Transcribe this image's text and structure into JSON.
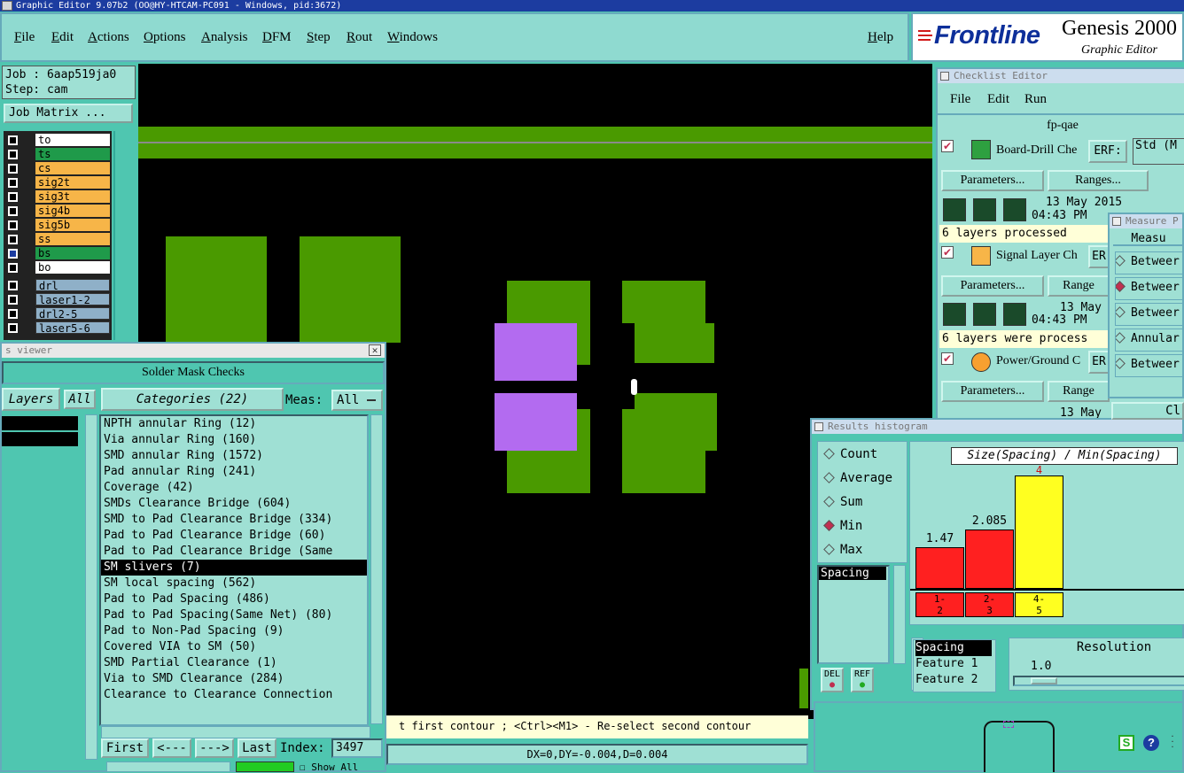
{
  "window": {
    "title": "Graphic Editor 9.07b2 (OO@HY-HTCAM-PC091 - Windows, pid:3672)"
  },
  "menu": {
    "items": [
      "File",
      "Edit",
      "Actions",
      "Options",
      "Analysis",
      "DFM",
      "Step",
      "Rout",
      "Windows"
    ],
    "help": "Help"
  },
  "brand": {
    "logo": "Frontline",
    "title": "Genesis 2000",
    "subtitle": "Graphic Editor"
  },
  "job": {
    "job_label": "Job : 6aap519ja0",
    "step_label": "Step: cam",
    "matrix_button": "Job Matrix ..."
  },
  "layers": [
    {
      "name": "to",
      "color": "#ffffff"
    },
    {
      "name": "ts",
      "color": "#1f9a4a"
    },
    {
      "name": "cs",
      "color": "#f7b548"
    },
    {
      "name": "sig2t",
      "color": "#f7b548"
    },
    {
      "name": "sig3t",
      "color": "#f7b548"
    },
    {
      "name": "sig4b",
      "color": "#f7b548"
    },
    {
      "name": "sig5b",
      "color": "#f7b548"
    },
    {
      "name": "ss",
      "color": "#f7b548"
    },
    {
      "name": "bs",
      "color": "#1f9a4a"
    },
    {
      "name": "bo",
      "color": "#ffffff"
    },
    {
      "name": "drl",
      "color": "#8fb0c8"
    },
    {
      "name": "laser1-2",
      "color": "#8fb0c8"
    },
    {
      "name": "drl2-5",
      "color": "#8fb0c8"
    },
    {
      "name": "laser5-6",
      "color": "#8fb0c8"
    }
  ],
  "checklist": {
    "title": "Checklist Editor",
    "menu": [
      "File",
      "Edit",
      "Run"
    ],
    "name": "fp-qae",
    "items": [
      {
        "label": "Board-Drill Che",
        "erf": "ERF:",
        "std": "Std (M",
        "params": "Parameters...",
        "ranges": "Ranges...",
        "date": "13 May 2015",
        "time": "04:43 PM",
        "status": "6 layers processed"
      },
      {
        "label": "Signal Layer Ch",
        "erf": "ER",
        "params": "Parameters...",
        "ranges": "Range",
        "date": "13 May",
        "time": "04:43 PM",
        "status": "6 layers were process"
      },
      {
        "label": "Power/Ground C",
        "erf": "ER",
        "params": "Parameters...",
        "ranges": "Range",
        "date": "13 May"
      }
    ]
  },
  "measure": {
    "title": "Measure P",
    "heading": "Measu",
    "options": [
      "Betweer",
      "Betweer",
      "Betweer",
      "Annular",
      "Betweer"
    ],
    "selected": 1
  },
  "sm_viewer": {
    "title": "s viewer",
    "heading": "Solder Mask Checks",
    "layers_label": "Layers",
    "layers_all": "All",
    "categories_label": "Categories (22)",
    "meas_label": "Meas:",
    "meas_value": "All",
    "categories": [
      "NPTH annular Ring (12)",
      "Via annular Ring (160)",
      "SMD annular Ring (1572)",
      "Pad annular Ring (241)",
      "Coverage (42)",
      "SMDs Clearance Bridge (604)",
      "SMD to Pad Clearance Bridge (334)",
      "Pad to Pad Clearance Bridge (60)",
      "Pad to Pad Clearance Bridge (Same",
      "SM slivers (7)",
      "SM local spacing (562)",
      "Pad to Pad Spacing (486)",
      "Pad to Pad Spacing(Same Net) (80)",
      "Pad to Non-Pad Spacing (9)",
      "Covered VIA to SM (50)",
      "SMD Partial Clearance (1)",
      "Via to SMD Clearance (284)",
      "Clearance to Clearance Connection"
    ],
    "selected_index": 9,
    "nav": {
      "first": "First",
      "prev": "<---",
      "next": "--->",
      "last": "Last",
      "index_label": "Index:",
      "index_value": "3497",
      "show_all": "Show All"
    }
  },
  "status": {
    "message": "t first contour ; <Ctrl><M1> - Re-select second contour",
    "coords": "DX=0,DY=-0.004,D=0.004"
  },
  "histogram": {
    "title": "Results histogram",
    "modes": [
      "Count",
      "Average",
      "Sum",
      "Min",
      "Max"
    ],
    "selected_mode": 3,
    "measure_list": [
      "Spacing"
    ],
    "chart_title": "Size(Spacing) / Min(Spacing)",
    "bars": [
      {
        "bin": "1-\n2",
        "value": 1.47,
        "label": "1.47",
        "color": "#ff2020"
      },
      {
        "bin": "2-\n3",
        "value": 2.085,
        "label": "2.085",
        "color": "#ff2020"
      },
      {
        "bin": "4-\n5",
        "value": 4,
        "label": "4",
        "color": "#ffff20"
      }
    ],
    "fields": [
      "Spacing",
      "Feature 1",
      "Feature 2"
    ],
    "resolution_label": "Resolution",
    "resolution_value": "1.0",
    "del": "DEL",
    "ref": "REF",
    "clear": "Cl"
  },
  "chart_data": {
    "type": "bar",
    "title": "Size(Spacing) / Min(Spacing)",
    "categories": [
      "1-2",
      "2-3",
      "4-5"
    ],
    "values": [
      1.47,
      2.085,
      4
    ]
  }
}
